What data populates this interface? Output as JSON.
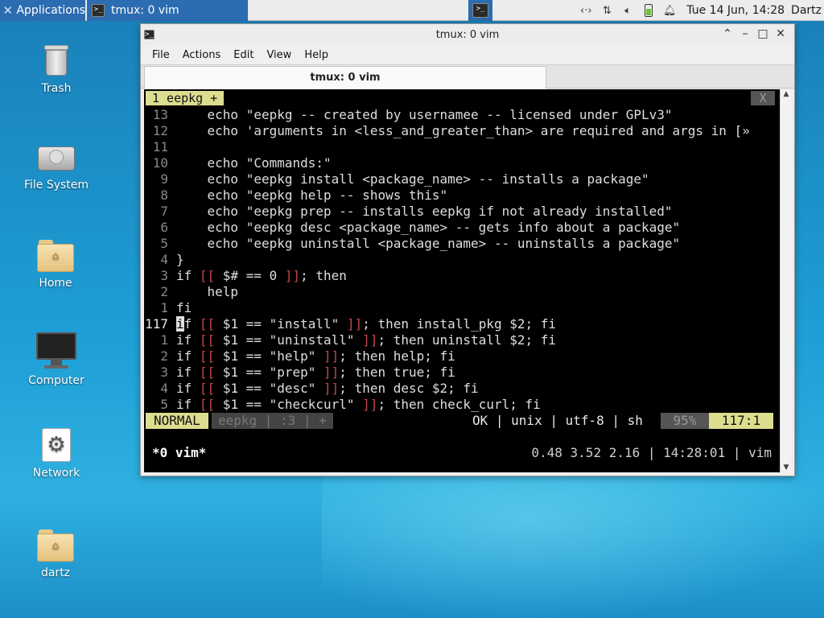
{
  "panel": {
    "apps_label": "Applications",
    "task_label": "tmux: 0 vim",
    "clock": "Tue 14 Jun, 14:28",
    "user": "Dartz",
    "tray_icons": [
      "network-arrows-icon",
      "transfer-icon",
      "volume-icon",
      "battery-icon",
      "bell-icon"
    ]
  },
  "desktop": {
    "icons": [
      {
        "label": "Trash",
        "icon": "trash-icon"
      },
      {
        "label": "File System",
        "icon": "drive-icon"
      },
      {
        "label": "Home",
        "icon": "home-folder-icon"
      },
      {
        "label": "Computer",
        "icon": "monitor-icon"
      },
      {
        "label": "Network",
        "icon": "network-gear-icon"
      },
      {
        "label": "dartz",
        "icon": "home-folder-icon"
      }
    ]
  },
  "window": {
    "title": "tmux: 0 vim",
    "menus": [
      "File",
      "Actions",
      "Edit",
      "View",
      "Help"
    ],
    "tab_label": "tmux: 0 vim"
  },
  "vim": {
    "tab_label": "1 eepkg +",
    "close_label": "X",
    "lines": [
      {
        "num": "13",
        "text": "    echo \"eepkg -- created by usernamee -- licensed under GPLv3\""
      },
      {
        "num": "12",
        "text": "    echo 'arguments in <less_and_greater_than> are required and args in [»"
      },
      {
        "num": "11",
        "text": ""
      },
      {
        "num": "10",
        "text": "    echo \"Commands:\""
      },
      {
        "num": "9",
        "text": "    echo \"eepkg install <package_name> -- installs a package\""
      },
      {
        "num": "8",
        "text": "    echo \"eepkg help -- shows this\""
      },
      {
        "num": "7",
        "text": "    echo \"eepkg prep -- installs eepkg if not already installed\""
      },
      {
        "num": "6",
        "text": "    echo \"eepkg desc <package_name> -- gets info about a package\""
      },
      {
        "num": "5",
        "text": "    echo \"eepkg uninstall <package_name> -- uninstalls a package\""
      },
      {
        "num": "4",
        "text": "}"
      },
      {
        "num": "3",
        "text": "if [[ $# == 0 ]]; then"
      },
      {
        "num": "2",
        "text": "    help"
      },
      {
        "num": "1",
        "text": "fi"
      },
      {
        "num": "117",
        "text": "if [[ $1 == \"install\" ]]; then install_pkg $2; fi"
      },
      {
        "num": "1",
        "text": "if [[ $1 == \"uninstall\" ]]; then uninstall $2; fi"
      },
      {
        "num": "2",
        "text": "if [[ $1 == \"help\" ]]; then help; fi"
      },
      {
        "num": "3",
        "text": "if [[ $1 == \"prep\" ]]; then true; fi"
      },
      {
        "num": "4",
        "text": "if [[ $1 == \"desc\" ]]; then desc $2; fi"
      },
      {
        "num": "5",
        "text": "if [[ $1 == \"checkcurl\" ]]; then check_curl; fi"
      }
    ],
    "status": {
      "mode": "NORMAL",
      "file": "eepkg | :3 | +",
      "info": "OK | unix | utf-8 | sh",
      "percent": "95%",
      "position": "117:1"
    }
  },
  "tmux": {
    "left": "*0 vim*",
    "right": "0.48 3.52 2.16 | 14:28:01 | vim"
  }
}
